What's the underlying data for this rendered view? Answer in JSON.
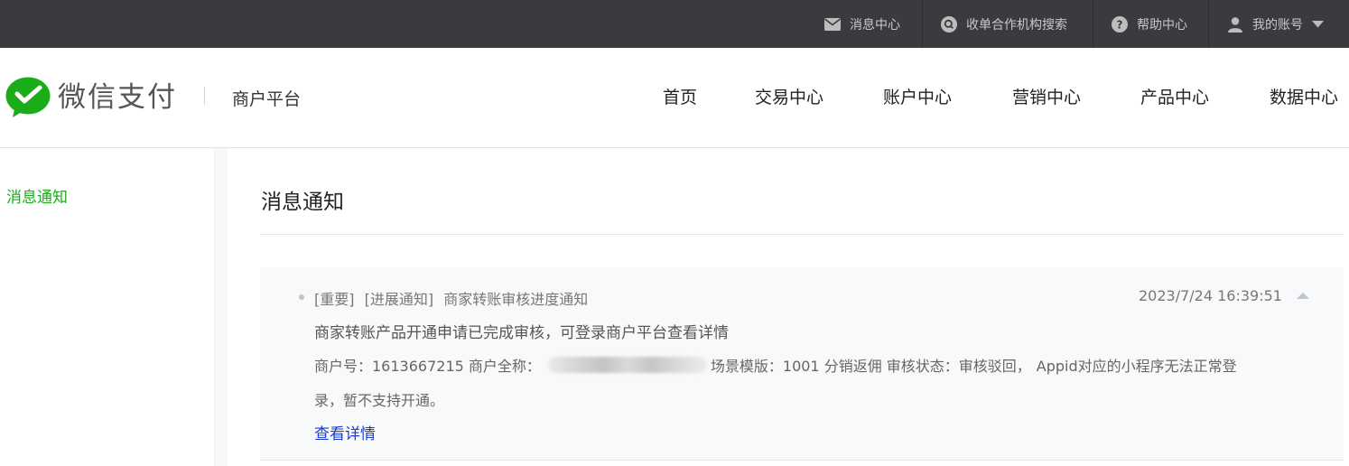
{
  "topbar": {
    "items": [
      {
        "label": "消息中心",
        "icon": "mail-icon"
      },
      {
        "label": "收单合作机构搜索",
        "icon": "search-icon"
      },
      {
        "label": "帮助中心",
        "icon": "help-icon"
      },
      {
        "label": "我的账号",
        "icon": "user-icon"
      }
    ]
  },
  "header": {
    "logo_text": "微信支付",
    "platform": "商户平台",
    "nav": [
      "首页",
      "交易中心",
      "账户中心",
      "营销中心",
      "产品中心",
      "数据中心"
    ]
  },
  "sidebar": {
    "items": [
      "消息通知"
    ]
  },
  "main": {
    "title": "消息通知",
    "message": {
      "tag_important": "[重要]",
      "tag_progress": "[进展通知]",
      "subject": "商家转账审核进度通知",
      "time": "2023/7/24 16:39:51",
      "summary": "商家转账产品开通申请已完成审核，可登录商户平台查看详情",
      "detail_prefix": "商户号：1613667215 商户全称：",
      "detail_suffix": "场景模版：1001 分销返佣 审核状态：审核驳回，",
      "detail_reason": "Appid对应的小程序无法正常登",
      "detail_line2": "录，暂不支持开通。",
      "link": "查看详情"
    }
  },
  "colors": {
    "topbar_bg": "#3b3b3f",
    "brand_green": "#1aad19",
    "link_blue": "#1a3ccf"
  }
}
